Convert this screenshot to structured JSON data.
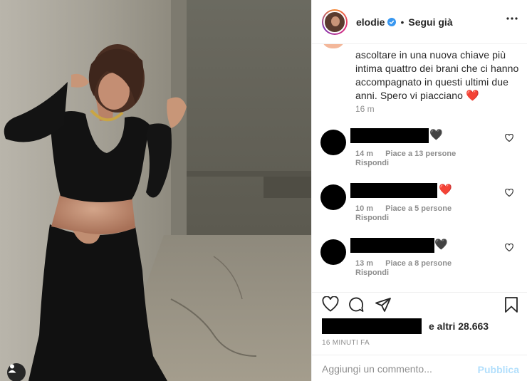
{
  "post": {
    "username": "elodie",
    "follow_status": "Segui già",
    "caption": "ascoltare in una nuova chiave più intima quattro dei brani che ci hanno accompagnato in questi ultimi due anni. Spero vi piacciano",
    "caption_heart": "❤️",
    "caption_time": "16 m",
    "likes_text": "e altri 28.663",
    "posted_time": "16 MINUTI FA"
  },
  "comments": [
    {
      "heart": "🖤",
      "heart_color": "#262626",
      "time": "14 m",
      "likes": "Piace a 13 persone",
      "reply": "Rispondi"
    },
    {
      "heart": "❤️",
      "heart_color": "#ed4956",
      "time": "10 m",
      "likes": "Piace a 5 persone",
      "reply": "Rispondi"
    },
    {
      "heart": "🖤",
      "heart_color": "#262626",
      "time": "13 m",
      "likes": "Piace a 8 persone",
      "reply": "Rispondi"
    }
  ],
  "add_comment": {
    "placeholder": "Aggiungi un commento...",
    "publish_label": "Pubblica"
  },
  "colors": {
    "accent_blue": "#0095f6",
    "publish_disabled": "#b2dffc",
    "muted_text": "#8e8e8e",
    "heart_red": "#ed4956"
  },
  "icons": [
    "user-tag-icon",
    "verified-icon",
    "more-options-icon",
    "like-icon",
    "comment-icon",
    "share-icon",
    "save-icon",
    "comment-like-icon"
  ]
}
